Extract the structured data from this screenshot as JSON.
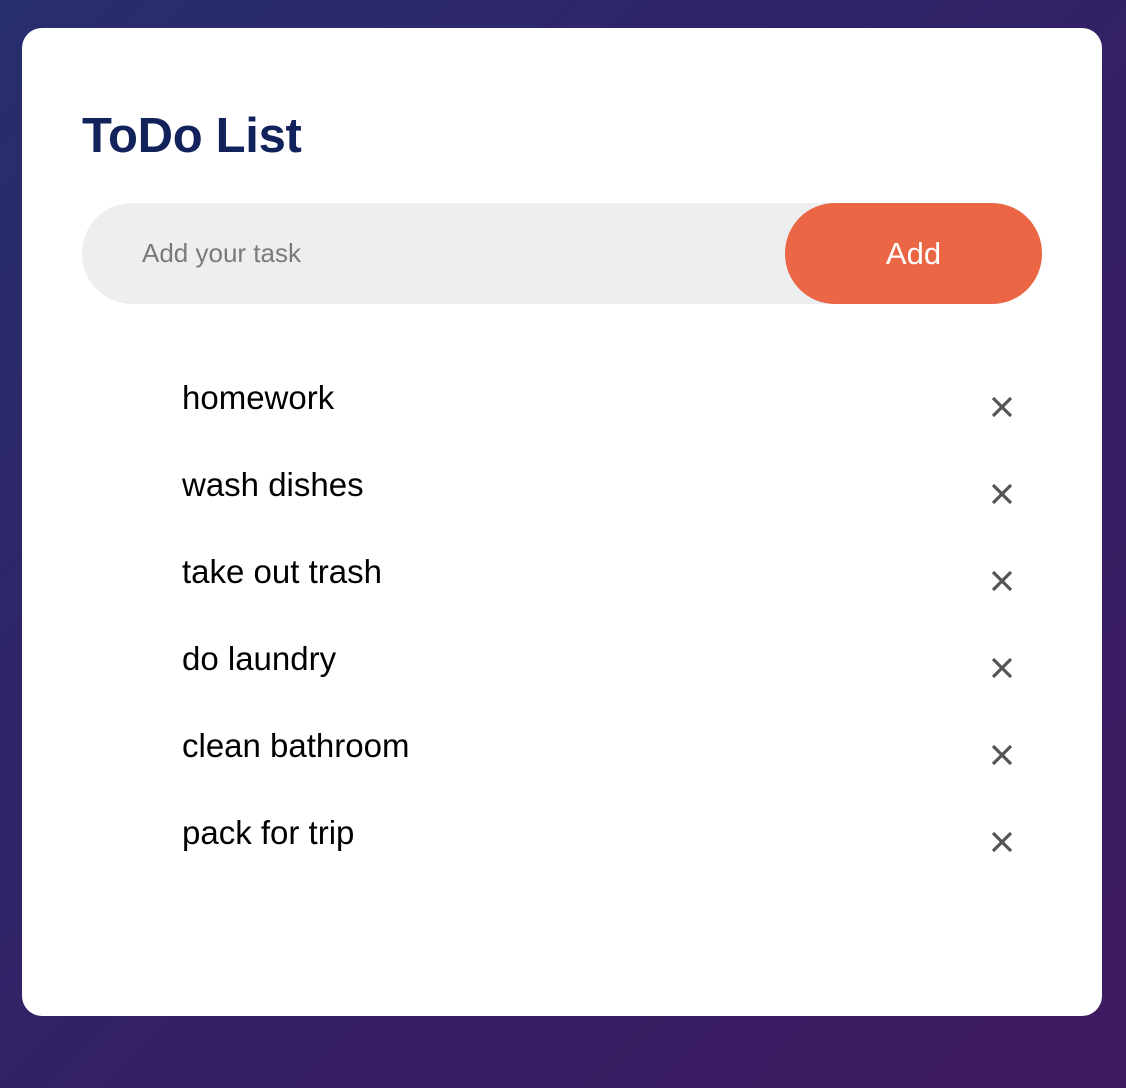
{
  "app": {
    "title": "ToDo List"
  },
  "input": {
    "placeholder": "Add your task",
    "value": "",
    "button_label": "Add"
  },
  "tasks": [
    {
      "label": "homework",
      "remove_icon": "close-icon"
    },
    {
      "label": "wash dishes",
      "remove_icon": "close-icon"
    },
    {
      "label": "take out trash",
      "remove_icon": "close-icon"
    },
    {
      "label": "do laundry",
      "remove_icon": "close-icon"
    },
    {
      "label": "clean bathroom",
      "remove_icon": "close-icon"
    },
    {
      "label": "pack for trip",
      "remove_icon": "close-icon"
    }
  ],
  "colors": {
    "title": "#12235b",
    "accent": "#eb6645",
    "input_background": "#edeef0",
    "icon": "#555555"
  }
}
